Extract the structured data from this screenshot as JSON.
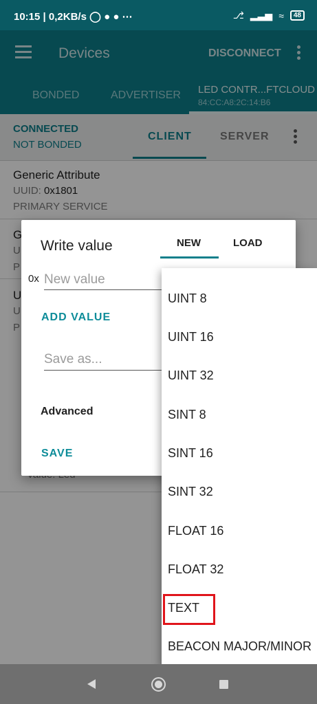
{
  "status_bar": {
    "time_speed": "10:15 | 0,2KB/s",
    "battery": "48"
  },
  "toolbar": {
    "title": "Devices",
    "disconnect": "DISCONNECT"
  },
  "device_tabs": {
    "bonded": "BONDED",
    "advertiser": "ADVERTISER",
    "led_name": "LED CONTR...FTCLOUD",
    "led_mac": "84:CC:A8:2C:14:B6"
  },
  "connection": {
    "status": "CONNECTED",
    "bond": "NOT BONDED",
    "client_tab": "CLIENT",
    "server_tab": "SERVER"
  },
  "services": [
    {
      "name": "Generic Attribute",
      "uuid_label": "UUID:",
      "uuid": "0x1801",
      "type": "PRIMARY SERVICE"
    },
    {
      "name": "G",
      "uuid_label": "U",
      "type": "P"
    },
    {
      "name": "U",
      "uuid_label": "U",
      "type": "P"
    }
  ],
  "background_value": "Value: Led",
  "dialog": {
    "title": "Write value",
    "tab_new": "NEW",
    "tab_load": "LOAD",
    "hex_prefix": "0x",
    "value_placeholder": "New value",
    "add_value": "ADD VALUE",
    "saveas_placeholder": "Save as...",
    "advanced": "Advanced",
    "save": "SAVE"
  },
  "dropdown": {
    "options": [
      "UINT 8",
      "UINT 16",
      "UINT 32",
      "SINT 8",
      "SINT 16",
      "SINT 32",
      "FLOAT 16",
      "FLOAT 32",
      "TEXT",
      "BEACON MAJOR/MINOR"
    ],
    "highlighted": "TEXT"
  },
  "colors": {
    "primary": "#0d7f8b",
    "status_bar": "#0a5a63",
    "accent": "#0d8c99",
    "highlight": "#e0141b"
  }
}
